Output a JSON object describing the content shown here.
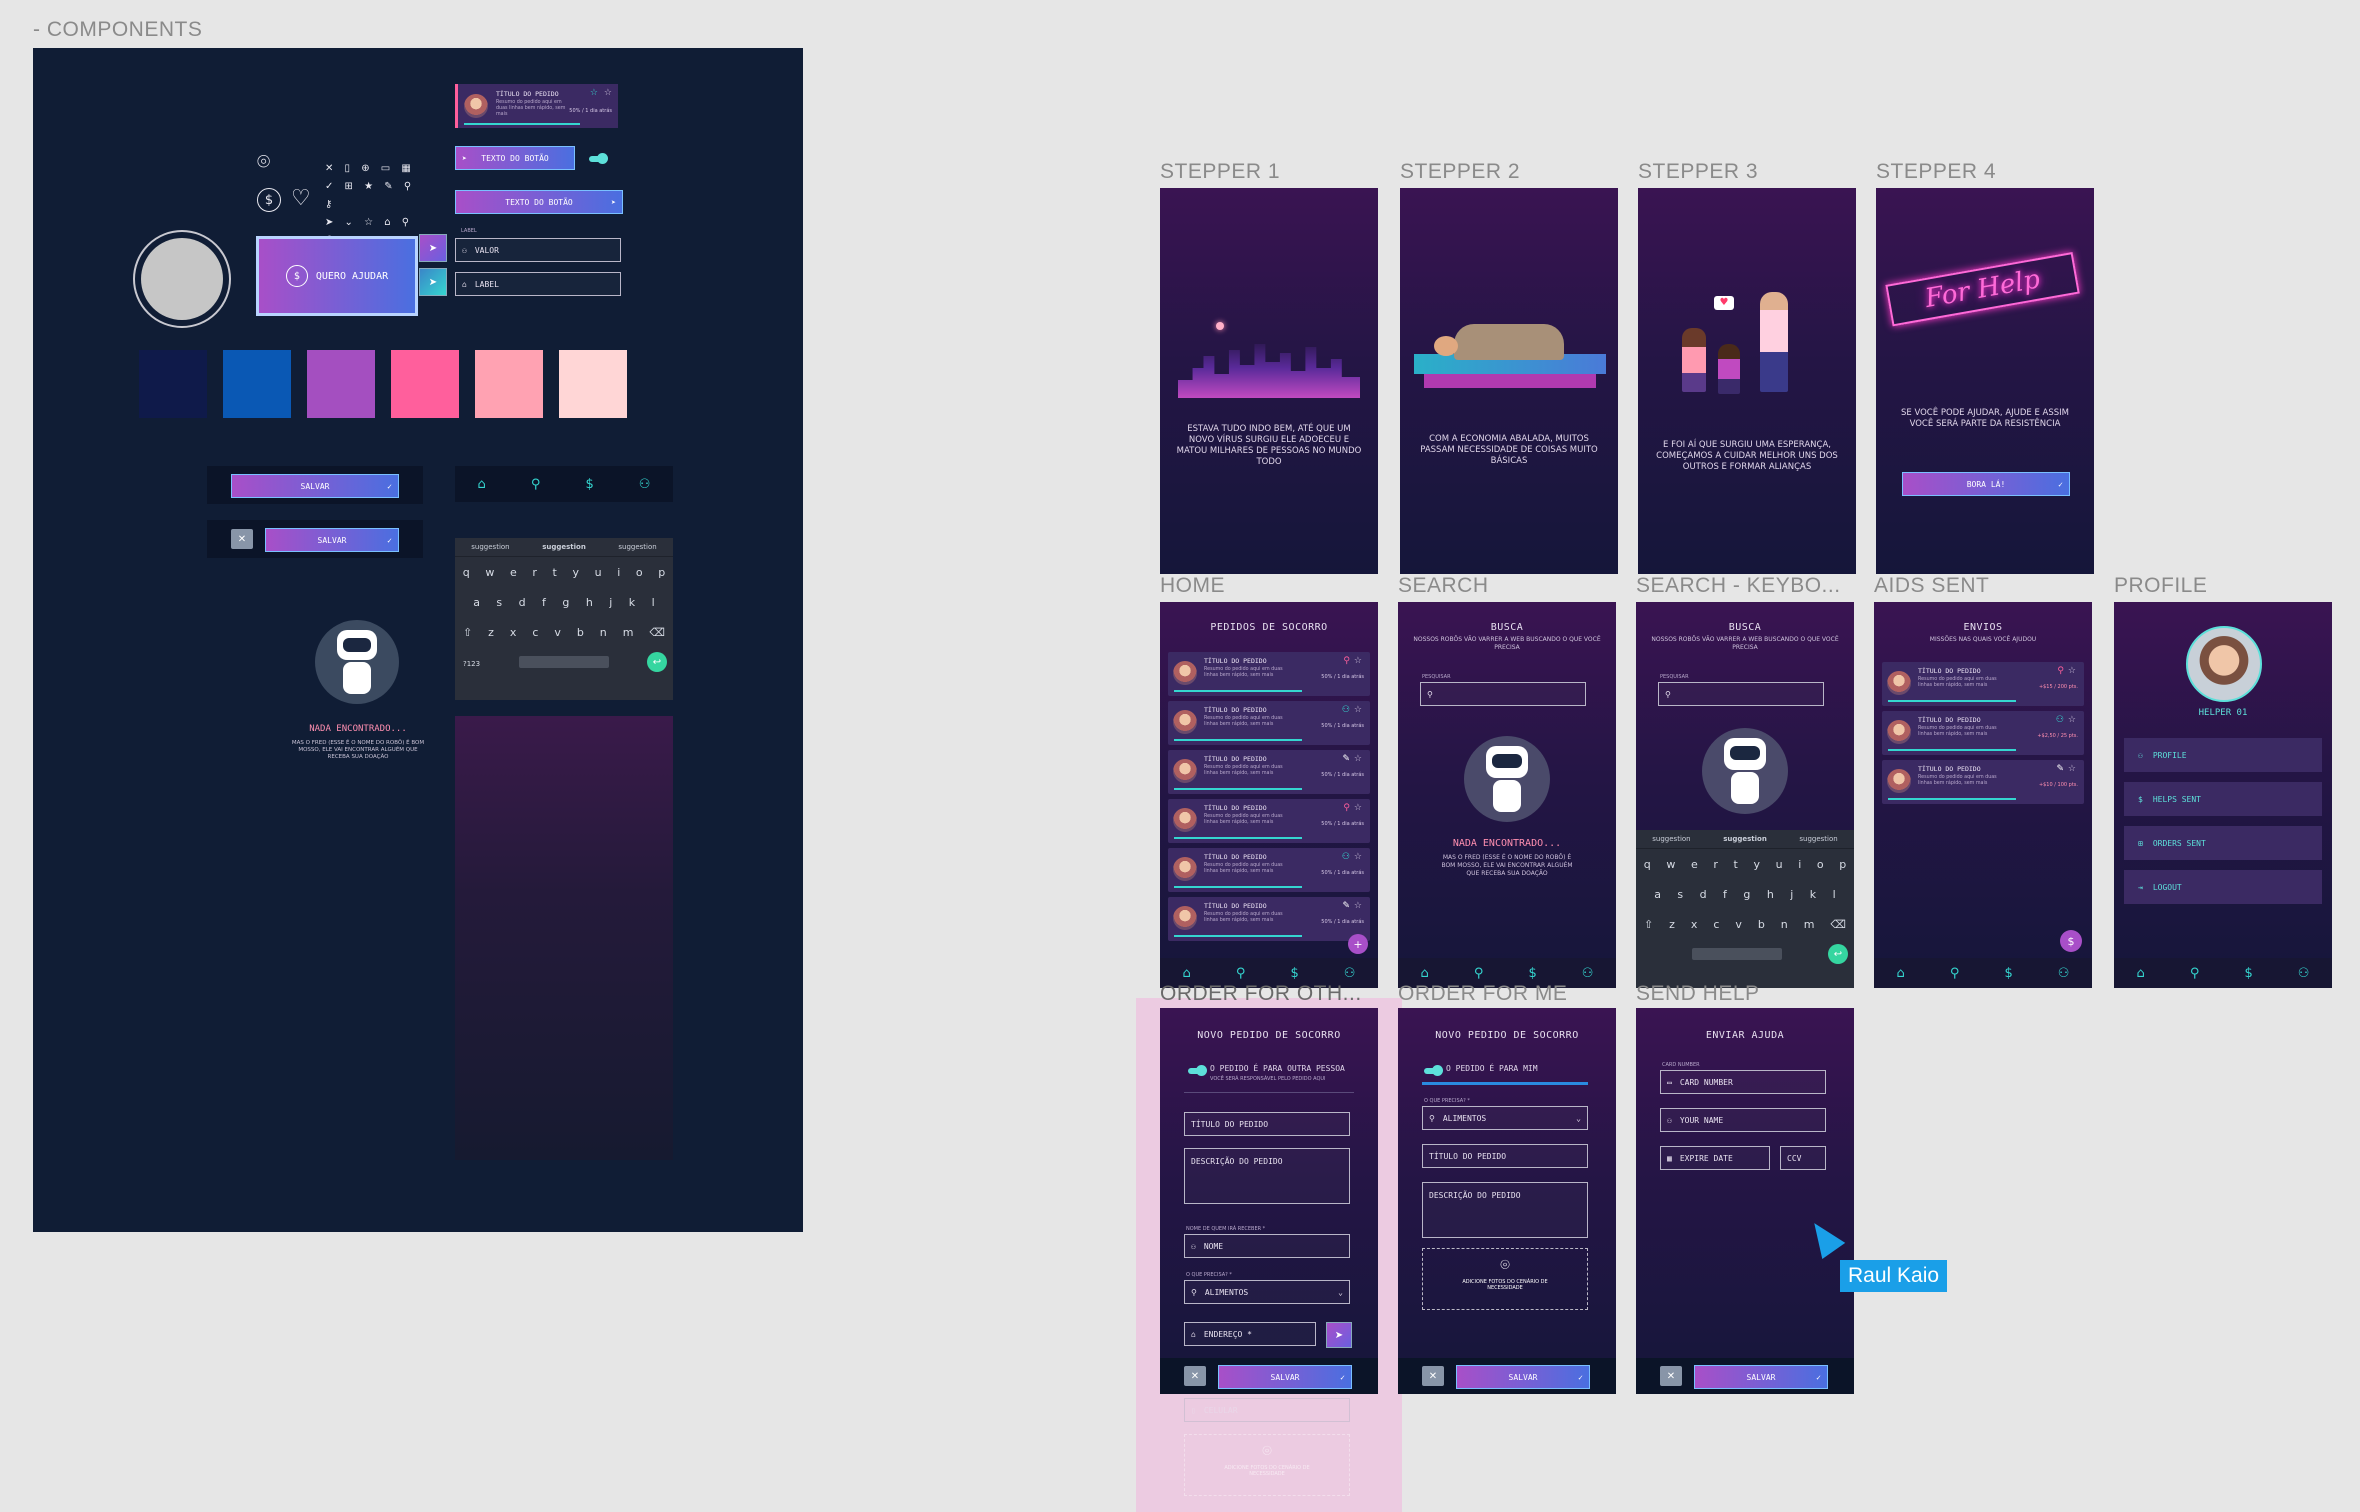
{
  "sections": {
    "components": "- COMPONENTS",
    "stepper1": "STEPPER 1",
    "stepper2": "STEPPER 2",
    "stepper3": "STEPPER 3",
    "stepper4": "STEPPER 4",
    "home": "HOME",
    "search": "SEARCH",
    "search_keyboard": "SEARCH - KEYBO...",
    "aids_sent": "AIDS SENT",
    "profile": "PROFILE",
    "order_other": "ORDER FOR OTH...",
    "order_me": "ORDER FOR ME",
    "send_help": "SEND HELP"
  },
  "components": {
    "card_title": "TÍTULO DO PEDIDO",
    "card_desc": "Resumo do pedido aqui em duas linhas bem rápido, sem mais",
    "card_meta": "50% / 1 dia atrás",
    "btn_text": "TEXTO DO BOTÃO",
    "quero_ajudar": "QUERO AJUDAR",
    "label_small": "LABEL",
    "input_valor": "VALOR",
    "input_label": "LABEL",
    "salvar": "SALVAR",
    "nada": "NADA ENCONTRADO...",
    "nada_desc": "MAS O FRED (ESSE É O NOME DO ROBÔ) É BOM MOSSO, ELE VAI ENCONTRAR ALGUÉM QUE RECEBA SUA DOAÇÃO",
    "suggestion": "suggestion",
    "colors": [
      "#0f1a4a",
      "#0a58b4",
      "#a44fc0",
      "#ff5f9c",
      "#ffa2b2",
      "#ffd6d6"
    ]
  },
  "keyboard": {
    "row1": [
      "q",
      "w",
      "e",
      "r",
      "t",
      "y",
      "u",
      "i",
      "o",
      "p"
    ],
    "row2": [
      "a",
      "s",
      "d",
      "f",
      "g",
      "h",
      "j",
      "k",
      "l"
    ],
    "row3": [
      "⇧",
      "z",
      "x",
      "c",
      "v",
      "b",
      "n",
      "m",
      "⌫"
    ],
    "num": "?123"
  },
  "stepper": {
    "s1": "ESTAVA TUDO INDO BEM, ATÉ QUE UM NOVO VÍRUS SURGIU ELE ADOECEU E MATOU MILHARES DE PESSOAS NO MUNDO TODO",
    "s2": "COM A ECONOMIA ABALADA, MUITOS PASSAM NECESSIDADE DE COISAS MUITO BÁSICAS",
    "s3": "E FOI AÍ QUE SURGIU UMA ESPERANÇA, COMEÇAMOS A CUIDAR MELHOR UNS DOS OUTROS E FORMAR ALIANÇAS",
    "s4": "SE VOCÊ PODE AJUDAR, AJUDE E ASSIM VOCÊ SERÁ PARTE DA RESISTÊNCIA",
    "s4_btn": "BORA LÁ!",
    "neon": "For Help"
  },
  "home": {
    "title": "PEDIDOS DE SOCORRO",
    "cards": [
      {
        "title": "TÍTULO DO PEDIDO",
        "meta": "50% / 1 dia atrás"
      },
      {
        "title": "TÍTULO DO PEDIDO",
        "meta": "50% / 1 dia atrás"
      },
      {
        "title": "TÍTULO DO PEDIDO",
        "meta": "50% / 1 dia atrás"
      },
      {
        "title": "TÍTULO DO PEDIDO",
        "meta": "50% / 1 dia atrás"
      },
      {
        "title": "TÍTULO DO PEDIDO",
        "meta": "50% / 1 dia atrás"
      },
      {
        "title": "TÍTULO DO PEDIDO",
        "meta": "50% / 1 dia atrás"
      }
    ]
  },
  "search": {
    "title": "BUSCA",
    "sub": "NOSSOS ROBÔS VÃO VARRER A WEB BUSCANDO O QUE VOCÊ PRECISA",
    "input_label": "PESQUISAR"
  },
  "aids": {
    "title": "ENVIOS",
    "sub": "MISSÕES NAS QUAIS VOCÊ AJUDOU",
    "cards": [
      {
        "title": "TÍTULO DO PEDIDO",
        "meta": "+$15 / 200 pts."
      },
      {
        "title": "TÍTULO DO PEDIDO",
        "meta": "+$2,50 / 25 pts."
      },
      {
        "title": "TÍTULO DO PEDIDO",
        "meta": "+$10 / 100 pts."
      }
    ]
  },
  "profile": {
    "name": "HELPER 01",
    "items": [
      "PROFILE",
      "HELPS SENT",
      "ORDERS SENT",
      "LOGOUT"
    ]
  },
  "order": {
    "title": "NOVO PEDIDO DE SOCORRO",
    "toggle_other": "O PEDIDO É PARA OUTRA PESSOA",
    "toggle_other_sub": "VOCÊ SERÁ RESPONSÁVEL PELO PEDIDO AQUI",
    "toggle_me": "O PEDIDO É PARA MIM",
    "titulo": "TÍTULO DO PEDIDO",
    "descricao": "DESCRIÇÃO DO PEDIDO",
    "nome_label": "NOME DE QUEM IRÁ RECEBER *",
    "nome": "NOME",
    "precisa_label": "O QUE PRECISA? *",
    "alimentos": "ALIMENTOS",
    "endereco": "ENDEREÇO *",
    "celular": "CELULAR",
    "fotos": "ADICIONE FOTOS DO CENÁRIO DE NECESSIDADE",
    "salvar": "SALVAR"
  },
  "send_help": {
    "title": "ENVIAR AJUDA",
    "card_label": "CARD NUMBER",
    "card_number": "CARD NUMBER",
    "your_name": "YOUR NAME",
    "expire": "EXPIRE DATE",
    "cvv": "CCV",
    "salvar": "SALVAR"
  },
  "cursor": {
    "user": "Raul Kaio"
  }
}
